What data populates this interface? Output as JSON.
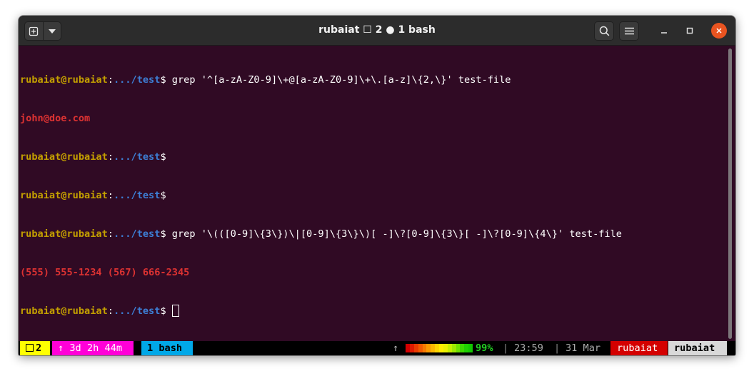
{
  "window": {
    "title": "rubaiat ☐ 2 ● 1 bash",
    "icons": {
      "new_tab": "new-tab-icon",
      "dropdown": "chevron-down-icon",
      "search": "search-icon",
      "menu": "hamburger-menu-icon",
      "minimize": "minimize-icon",
      "maximize": "maximize-icon",
      "close": "close-icon"
    },
    "colors": {
      "titlebar": "#2c2c2c",
      "close": "#e95420",
      "terminal_bg": "#300a24"
    }
  },
  "terminal": {
    "lines": [
      {
        "user": "rubaiat@rubaiat",
        "sep": ":",
        "path": ".../test",
        "dollar": "$",
        "command": " grep '^[a-zA-Z0-9]\\+@[a-zA-Z0-9]\\+\\.[a-z]\\{2,\\}' test-file"
      },
      {
        "output": "john@doe.com"
      },
      {
        "user": "rubaiat@rubaiat",
        "sep": ":",
        "path": ".../test",
        "dollar": "$",
        "command": ""
      },
      {
        "user": "rubaiat@rubaiat",
        "sep": ":",
        "path": ".../test",
        "dollar": "$",
        "command": ""
      },
      {
        "user": "rubaiat@rubaiat",
        "sep": ":",
        "path": ".../test",
        "dollar": "$",
        "command": " grep '\\(([0-9]\\{3\\})\\|[0-9]\\{3\\}\\)[ -]\\?[0-9]\\{3\\}[ -]\\?[0-9]\\{4\\}' test-file"
      },
      {
        "output": "(555) 555-1234 (567) 666-2345"
      },
      {
        "user": "rubaiat@rubaiat",
        "sep": ":",
        "path": ".../test",
        "dollar": "$",
        "command": " "
      }
    ]
  },
  "status_bar": {
    "window_count": "2",
    "uptime": "↑ 3d 2h 44m",
    "window_name": "1 bash",
    "arrow": "↑",
    "battery_percent": "99%",
    "battery_level": 0.99,
    "divider": "|",
    "time": "23:59",
    "date": "31 Mar",
    "user": "rubaiat",
    "host": "rubaiat",
    "colors": {
      "window_seg": "#ffff00",
      "uptime_seg": "#ff00d8",
      "bash_seg": "#00a8e8",
      "user_seg": "#d40000",
      "host_seg": "#d9d9d9"
    }
  }
}
